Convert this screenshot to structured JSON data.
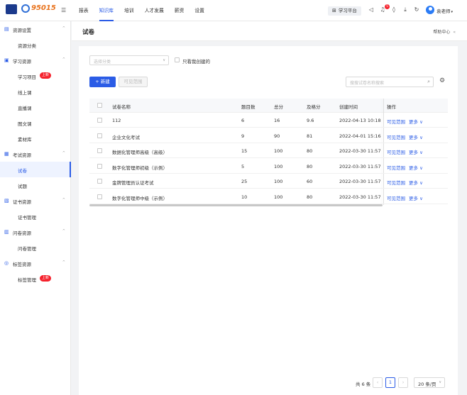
{
  "header": {
    "logo_text": "95015",
    "nav": [
      "报表",
      "知识库",
      "培训",
      "人才发展",
      "薪资",
      "设置"
    ],
    "active_nav": "知识库",
    "learning_platform": "学习平台",
    "notification_count": "5",
    "user_name": "袁老师"
  },
  "sidebar": {
    "groups": [
      {
        "label": "资源设置",
        "items": [
          {
            "label": "资源分类"
          }
        ]
      },
      {
        "label": "学习资源",
        "items": [
          {
            "label": "学习项目",
            "tag": "上新"
          },
          {
            "label": "线上课"
          },
          {
            "label": "直播课"
          },
          {
            "label": "图文课"
          },
          {
            "label": "素材库"
          }
        ]
      },
      {
        "label": "考试资源",
        "items": [
          {
            "label": "试卷",
            "active": true
          },
          {
            "label": "试题"
          }
        ]
      },
      {
        "label": "证书资源",
        "items": [
          {
            "label": "证书管理"
          }
        ]
      },
      {
        "label": "问卷资源",
        "items": [
          {
            "label": "问卷管理"
          }
        ]
      },
      {
        "label": "标签资源",
        "items": [
          {
            "label": "标签管理",
            "tag": "上新"
          }
        ]
      }
    ]
  },
  "page": {
    "title": "试卷",
    "help": "帮助中心",
    "filter": {
      "category_placeholder": "选择分类",
      "only_mine": "只看我创建的"
    },
    "toolbar": {
      "new_label": "+ 新建",
      "scope_label": "可见范围",
      "search_placeholder": "搜搜试卷名称搜索"
    },
    "table": {
      "columns": [
        "试卷名称",
        "题目数",
        "总分",
        "及格分",
        "创建时间",
        "操作"
      ],
      "rows": [
        {
          "name": "112",
          "count": "6",
          "total": "16",
          "pass": "9.6",
          "created": "2022-04-13 10:18"
        },
        {
          "name": "企业文化考试",
          "count": "9",
          "total": "90",
          "pass": "81",
          "created": "2022-04-01 15:16"
        },
        {
          "name": "数据化管理师高级（高级）",
          "count": "15",
          "total": "100",
          "pass": "80",
          "created": "2022-03-30 11:57"
        },
        {
          "name": "数字化管理师初级（示例）",
          "count": "5",
          "total": "100",
          "pass": "80",
          "created": "2022-03-30 11:57"
        },
        {
          "name": "金牌管理员认证考试",
          "count": "25",
          "total": "100",
          "pass": "60",
          "created": "2022-03-30 11:57"
        },
        {
          "name": "数字化管理师中级（示例）",
          "count": "10",
          "total": "100",
          "pass": "80",
          "created": "2022-03-30 11:57"
        }
      ],
      "op_scope": "可见范围",
      "op_more": "更多"
    },
    "pagination": {
      "total": "共 6 条",
      "current": "1",
      "page_size": "20 条/页"
    }
  }
}
